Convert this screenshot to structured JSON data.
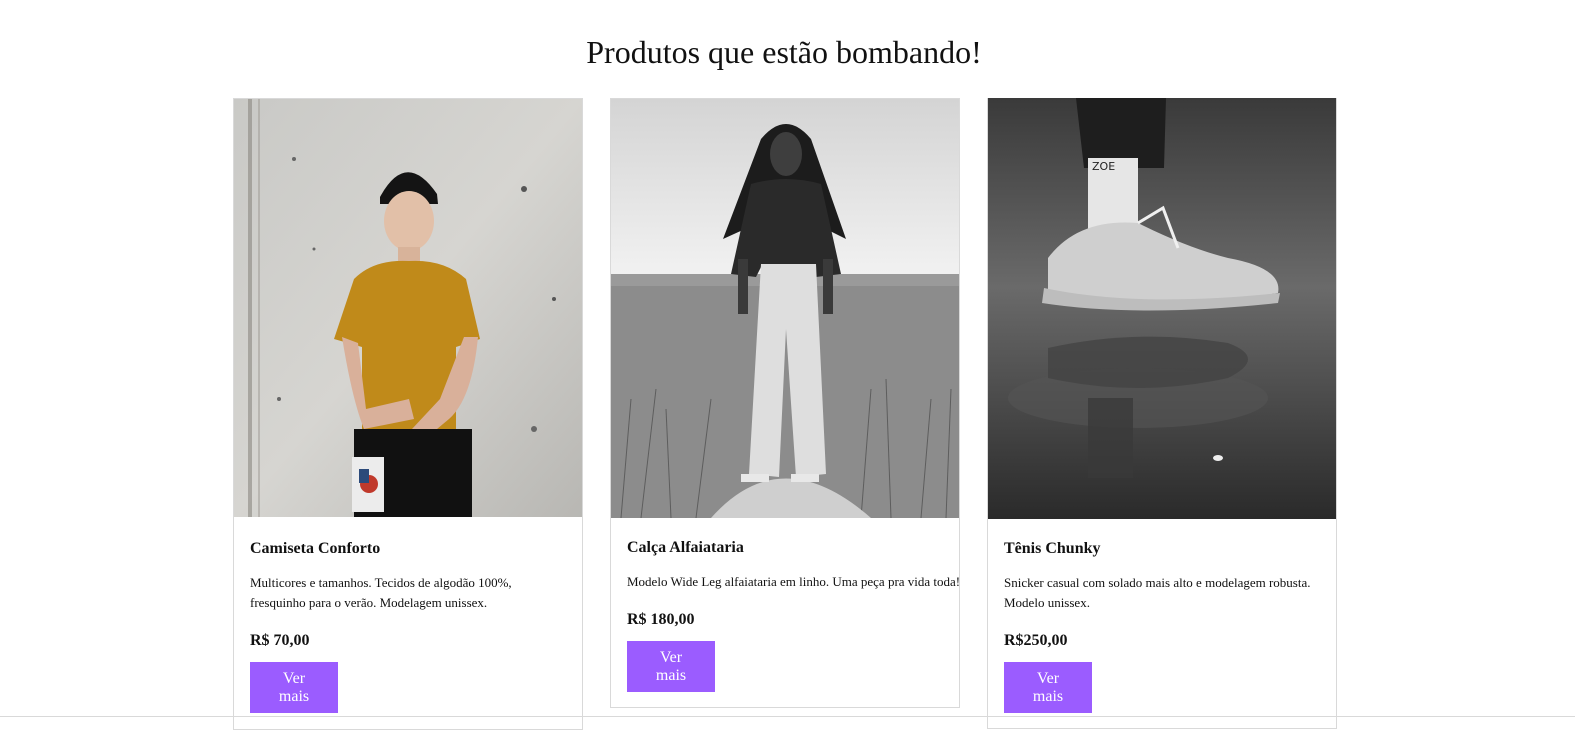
{
  "page": {
    "title": "Produtos que estão bombando!"
  },
  "products": [
    {
      "name": "Camiseta Conforto",
      "description": "Multicores e tamanhos. Tecidos de algodão 100%, fresquinho para o verão. Modelagem unissex.",
      "price": "R$ 70,00",
      "button_label": "Ver mais"
    },
    {
      "name": "Calça Alfaiataria",
      "description": "Modelo Wide Leg alfaiataria em linho. Uma peça pra vida toda!",
      "price": "R$ 180,00",
      "button_label": "Ver mais"
    },
    {
      "name": "Tênis Chunky",
      "description": "Snicker casual com solado mais alto e modelagem robusta. Modelo unissex.",
      "price": "R$250,00",
      "button_label": "Ver mais"
    }
  ],
  "colors": {
    "button_bg": "#9b5cff",
    "card_border": "#d9d9d9"
  }
}
